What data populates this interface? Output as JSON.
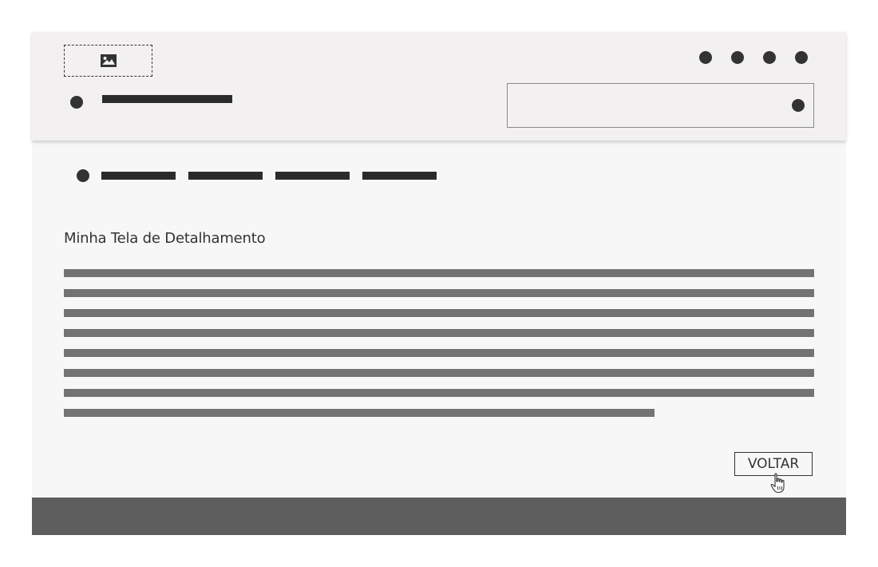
{
  "header": {
    "logo_icon": "image-icon",
    "top_dots": [
      "dot",
      "dot",
      "dot",
      "dot"
    ],
    "search_icon": "dot"
  },
  "nav": {
    "items": [
      "placeholder",
      "placeholder",
      "placeholder",
      "placeholder"
    ]
  },
  "main": {
    "title": "Minha Tela de Detalhamento",
    "paragraph_lines": 8
  },
  "actions": {
    "back_label": "VOLTAR",
    "cursor_icon": "hand-pointer-icon"
  },
  "colors": {
    "header_bg": "#f2f0f1",
    "page_bg": "#f7f7f7",
    "footer_bg": "#5e5e5e",
    "text_dark": "#333333",
    "placeholder_text": "#737373"
  }
}
